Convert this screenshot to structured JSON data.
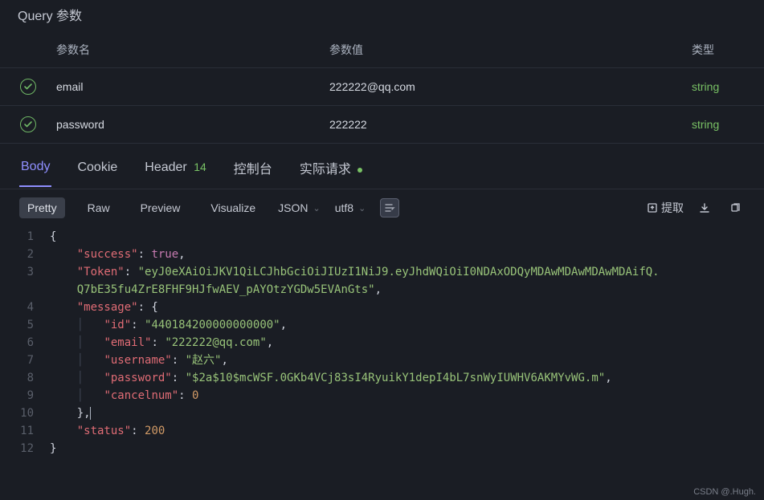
{
  "section_title": "Query 参数",
  "table": {
    "headers": {
      "name": "参数名",
      "value": "参数值",
      "type": "类型"
    },
    "rows": [
      {
        "name": "email",
        "value": "222222@qq.com",
        "type": "string"
      },
      {
        "name": "password",
        "value": "222222",
        "type": "string"
      }
    ]
  },
  "tabs": {
    "body": "Body",
    "cookie": "Cookie",
    "header": "Header",
    "header_count": "14",
    "console": "控制台",
    "request": "实际请求"
  },
  "views": {
    "pretty": "Pretty",
    "raw": "Raw",
    "preview": "Preview",
    "visualize": "Visualize"
  },
  "format": {
    "mode": "JSON",
    "enc": "utf8"
  },
  "actions": {
    "extract": "提取"
  },
  "json_body": {
    "l1": "{",
    "l2_key": "\"success\"",
    "l2_v": "true",
    "l3_key": "\"Token\"",
    "l3_v1": "\"eyJ0eXAiOiJKV1QiLCJhbGciOiJIUzI1NiJ9.eyJhdWQiOiI0NDAxODQyMDAwMDAwMDAwMDAifQ.",
    "l3_v2": "Q7bE35fu4ZrE8FHF9HJfwAEV_pAYOtzYGDw5EVAnGts\"",
    "l4_key": "\"message\"",
    "l5_key": "\"id\"",
    "l5_v": "\"440184200000000000\"",
    "l6_key": "\"email\"",
    "l6_v": "\"222222@qq.com\"",
    "l7_key": "\"username\"",
    "l7_v": "\"赵六\"",
    "l8_key": "\"password\"",
    "l8_v": "\"$2a$10$mcWSF.0GKb4VCj83sI4RyuikY1depI4bL7snWyIUWHV6AKMYvWG.m\"",
    "l9_key": "\"cancelnum\"",
    "l9_v": "0",
    "l11_key": "\"status\"",
    "l11_v": "200",
    "l12": "}"
  },
  "watermark": "CSDN @.Hugh.",
  "chart_data": {
    "type": "table",
    "title": "Response JSON body",
    "success": true,
    "Token": "eyJ0eXAiOiJKV1QiLCJhbGciOiJIUzI1NiJ9.eyJhdWQiOiI0NDAxODQyMDAwMDAwMDAwMDAifQ.Q7bE35fu4ZrE8FHF9HJfwAEV_pAYOtzYGDw5EVAnGts",
    "message": {
      "id": "440184200000000000",
      "email": "222222@qq.com",
      "username": "赵六",
      "password": "$2a$10$mcWSF.0GKb4VCj83sI4RyuikY1depI4bL7snWyIUWHV6AKMYvWG.m",
      "cancelnum": 0
    },
    "status": 200
  }
}
